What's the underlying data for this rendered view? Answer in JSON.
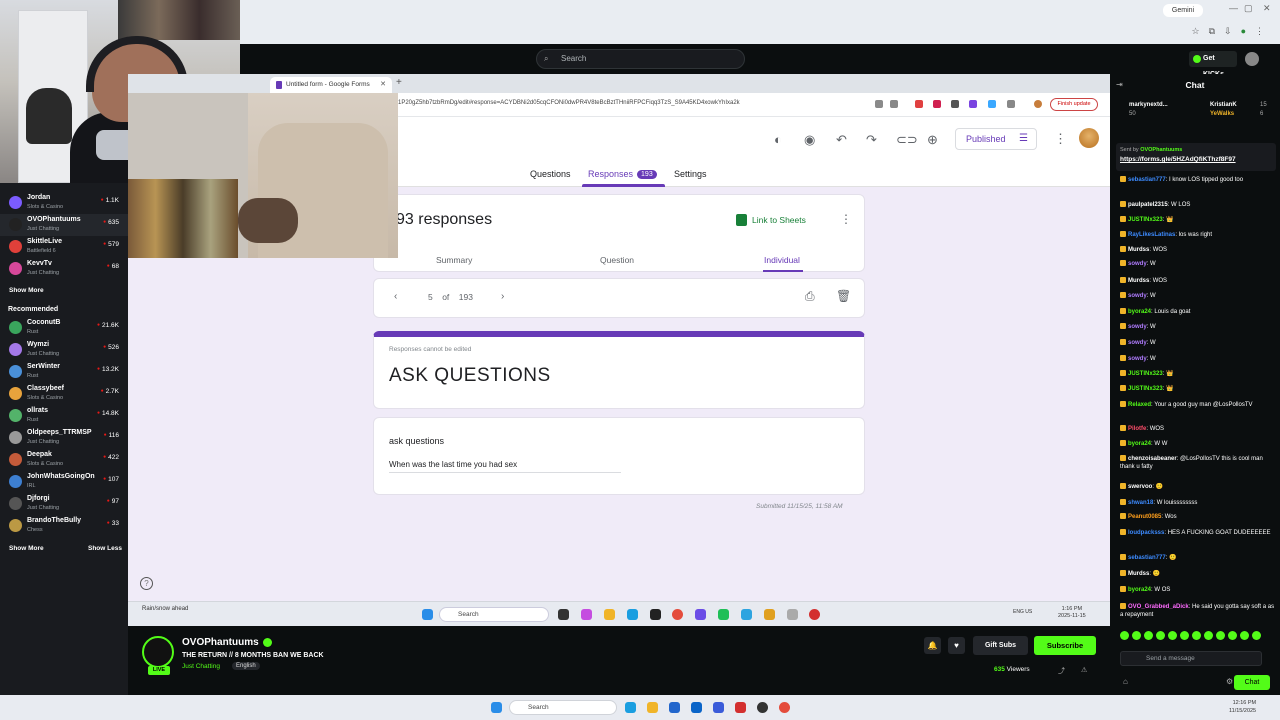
{
  "browser": {
    "gemini": "Gemini",
    "tab_title": "Untitled form - Google Forms",
    "url": "1P20gZ5hb7tzbRmDg/edit#response=ACYDBNi2d05cqCFONi0dwPR4V8teBcBztTHniiRFPCFiqq3TzS_S9A45KD4xowkYhIxa2k",
    "finish_update": "Finish update"
  },
  "kick": {
    "search_placeholder": "Search",
    "get_kicks": "Get KICKs"
  },
  "sidebar": {
    "top_channels": [
      {
        "name": "Jordan",
        "category": "Slots & Casino",
        "viewers": "1.1K",
        "color": "#7b5cff"
      },
      {
        "name": "OVOPhantuums",
        "category": "Just Chatting",
        "viewers": "635",
        "color": "#222"
      },
      {
        "name": "SkittleLive",
        "category": "Battlefield 6",
        "viewers": "579",
        "color": "#e0403a"
      },
      {
        "name": "KevvTv",
        "category": "Just Chatting",
        "viewers": "68",
        "color": "#d6489a"
      }
    ],
    "show_more_1": "Show More",
    "recommended_label": "Recommended",
    "recommended": [
      {
        "name": "CoconutB",
        "category": "Rust",
        "viewers": "21.6K",
        "color": "#3aa55d"
      },
      {
        "name": "Wymzi",
        "category": "Just Chatting",
        "viewers": "526",
        "color": "#a478e8"
      },
      {
        "name": "SerWinter",
        "category": "Rust",
        "viewers": "13.2K",
        "color": "#4a90d9"
      },
      {
        "name": "Classybeef",
        "category": "Slots & Casino",
        "viewers": "2.7K",
        "color": "#e8a33c"
      },
      {
        "name": "ollrats",
        "category": "Rust",
        "viewers": "14.8K",
        "color": "#53b36a"
      },
      {
        "name": "Oldpeeps_TTRMSP",
        "category": "Just Chatting",
        "viewers": "116",
        "color": "#999"
      },
      {
        "name": "Deepak",
        "category": "Slots & Casino",
        "viewers": "422",
        "color": "#c45b3a"
      },
      {
        "name": "JohnWhatsGoingOn",
        "category": "IRL",
        "viewers": "107",
        "color": "#3d7fd1"
      },
      {
        "name": "Djforgi",
        "category": "Just Chatting",
        "viewers": "97",
        "color": "#555"
      },
      {
        "name": "BrandoTheBully",
        "category": "Chess",
        "viewers": "33",
        "color": "#b94"
      }
    ],
    "show_more_2": "Show More",
    "show_less": "Show Less"
  },
  "forms": {
    "published": "Published",
    "tabs": [
      "Questions",
      "Responses",
      "Settings"
    ],
    "responses_badge": "193",
    "responses_count": "93 responses",
    "link_sheets": "Link to Sheets",
    "sub_tabs": [
      "Summary",
      "Question",
      "Individual"
    ],
    "current": "5",
    "of": "of",
    "total": "193",
    "cannot_edit": "Responses cannot be edited",
    "form_title": "ASK QUESTIONS",
    "question": "ask questions",
    "answer": "When was the last time you had sex",
    "submitted": "Submitted 11/15/25, 11:58 AM"
  },
  "inner_taskbar": {
    "weather": "Rain/snow ahead",
    "search": "Search",
    "tray_lang": "ENG US",
    "time": "1:16 PM",
    "date": "2025-11-15"
  },
  "chat": {
    "title": "Chat",
    "gifters": [
      {
        "name": "markynextd...",
        "count": "50"
      },
      {
        "name": "KristianK",
        "count": "15"
      },
      {
        "name": "YeWalks",
        "count": "6"
      }
    ],
    "pinned_by": "Sent by",
    "pinned_user": "OVOPhantuums",
    "pinned_link": "https://forms.gle/5HZAdQfiKThzf8F97",
    "messages": [
      {
        "user": "sebastian777",
        "text": "I know LOS tipped good too",
        "color": "#3d8bff"
      },
      {
        "user": "paulpatel2315",
        "text": "W LOS",
        "color": "#fff"
      },
      {
        "user": "JUSTINx323",
        "text": "👑",
        "color": "#53fc18"
      },
      {
        "user": "RayLikesLatinas",
        "text": "los was right",
        "color": "#3d8bff"
      },
      {
        "user": "Murdss",
        "text": "WOS",
        "color": "#fff"
      },
      {
        "user": "sowdy",
        "text": "W",
        "color": "#b07cff"
      },
      {
        "user": "Murdss",
        "text": "WOS",
        "color": "#fff"
      },
      {
        "user": "sowdy",
        "text": "W",
        "color": "#b07cff"
      },
      {
        "user": "byora24",
        "text": "Louis da goat",
        "color": "#53fc18"
      },
      {
        "user": "sowdy",
        "text": "W",
        "color": "#b07cff"
      },
      {
        "user": "sowdy",
        "text": "W",
        "color": "#b07cff"
      },
      {
        "user": "sowdy",
        "text": "W",
        "color": "#b07cff"
      },
      {
        "user": "JUSTINx323",
        "text": "👑",
        "color": "#53fc18"
      },
      {
        "user": "JUSTINx323",
        "text": "👑",
        "color": "#53fc18"
      },
      {
        "user": "Relaxed",
        "text": "Your a good guy man @LosPollosTV",
        "color": "#53fc18"
      },
      {
        "user": "Pilotfe",
        "text": "WOS",
        "color": "#ff4d6a"
      },
      {
        "user": "byora24",
        "text": "W W",
        "color": "#53fc18"
      },
      {
        "user": "chenzoisabeaner",
        "text": "@LosPollosTV this is cool man thank u fatty",
        "color": "#fff"
      },
      {
        "user": "swervoo",
        "text": "🙂",
        "color": "#fff"
      },
      {
        "user": "shwan18",
        "text": "W louissssssss",
        "color": "#3d8bff"
      },
      {
        "user": "Peanut0085",
        "text": "Wos",
        "color": "#ff9f1c"
      },
      {
        "user": "loudpacksss",
        "text": "HES A FUCKING GOAT DUDEEEEEE",
        "color": "#3d8bff"
      },
      {
        "user": "sebastian777",
        "text": "🙂",
        "color": "#3d8bff"
      },
      {
        "user": "Murdss",
        "text": "🙂",
        "color": "#fff"
      },
      {
        "user": "byora24",
        "text": "W OS",
        "color": "#53fc18"
      },
      {
        "user": "OVO_Grabbed_aDick",
        "text": "He said you gotta say soft a as a repayment",
        "color": "#ff6bff"
      }
    ],
    "input_placeholder": "Send a message",
    "send": "Chat"
  },
  "stream": {
    "streamer": "OVOPhantuums",
    "title": "THE RETURN // 8 MONTHS BAN WE BACK",
    "category": "Just Chatting",
    "language": "English",
    "gift_subs": "Gift Subs",
    "subscribe": "Subscribe",
    "viewers": "635",
    "viewers_label": "Viewers",
    "live": "LIVE"
  },
  "host_taskbar": {
    "search": "Search",
    "time": "12:16 PM",
    "date": "11/15/2025"
  }
}
